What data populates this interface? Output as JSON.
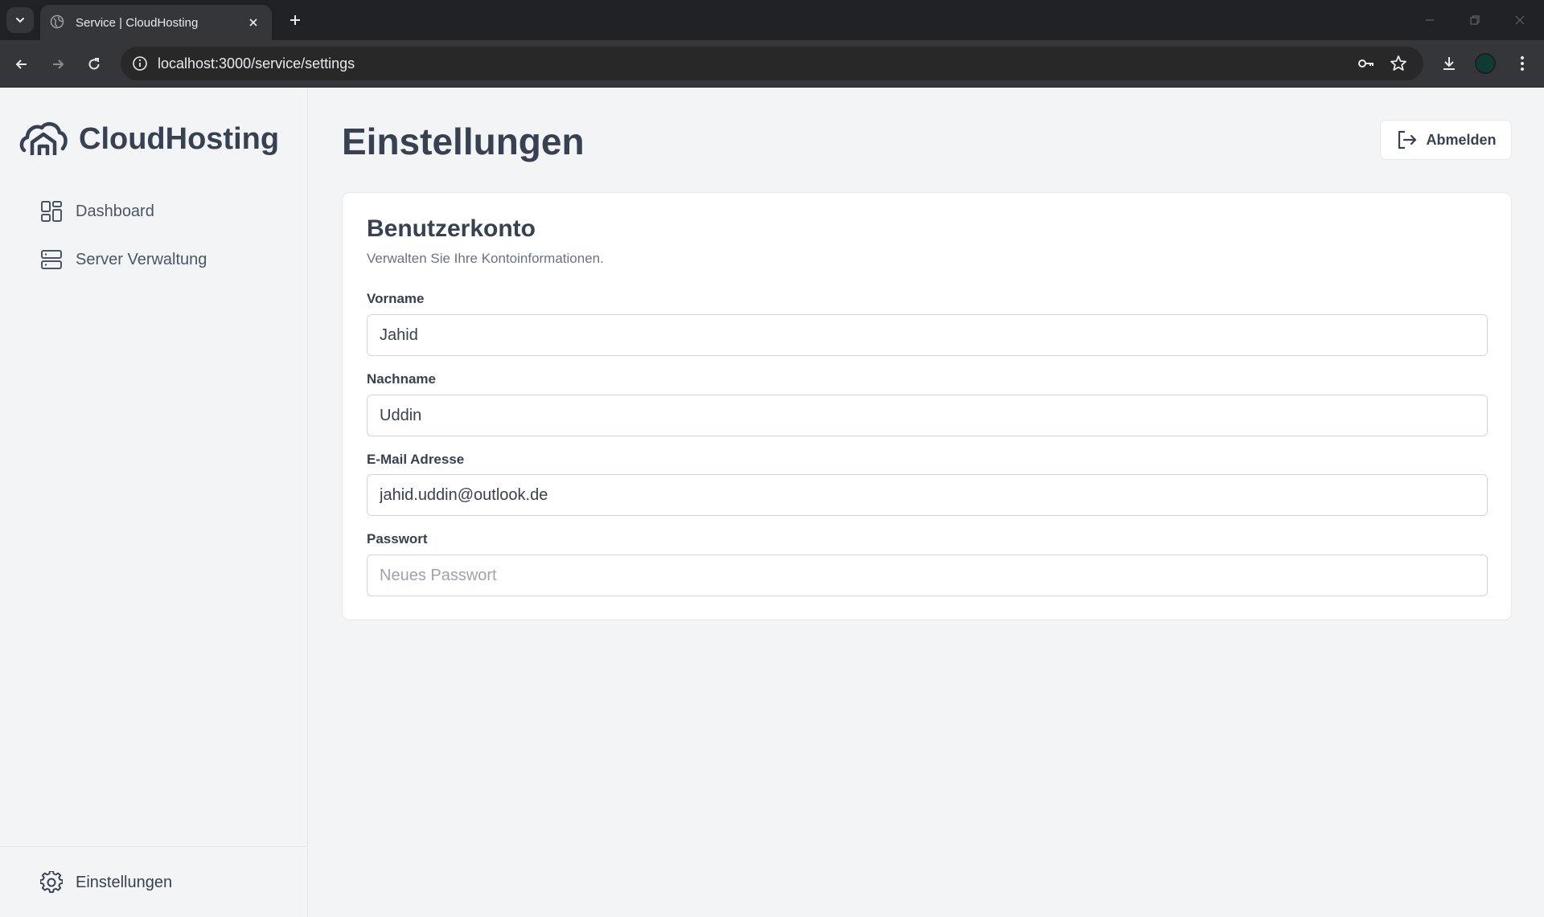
{
  "browser": {
    "tab_title": "Service | CloudHosting",
    "url": "localhost:3000/service/settings"
  },
  "sidebar": {
    "brand": "CloudHosting",
    "items": [
      {
        "label": "Dashboard",
        "icon": "dashboard-grid-icon"
      },
      {
        "label": "Server Verwaltung",
        "icon": "server-icon"
      }
    ],
    "footer_item": {
      "label": "Einstellungen",
      "icon": "gear-icon"
    }
  },
  "header": {
    "title": "Einstellungen",
    "logout_label": "Abmelden"
  },
  "account": {
    "title": "Benutzerkonto",
    "subtitle": "Verwalten Sie Ihre Kontoinformationen.",
    "fields": [
      {
        "label": "Vorname",
        "value": "Jahid",
        "placeholder": ""
      },
      {
        "label": "Nachname",
        "value": "Uddin",
        "placeholder": ""
      },
      {
        "label": "E-Mail Adresse",
        "value": "jahid.uddin@outlook.de",
        "placeholder": ""
      },
      {
        "label": "Passwort",
        "value": "",
        "placeholder": "Neues Passwort"
      }
    ]
  },
  "colors": {
    "page_bg": "#f3f4f6",
    "text": "#374151",
    "muted": "#6b7280",
    "border": "#e5e7eb"
  }
}
